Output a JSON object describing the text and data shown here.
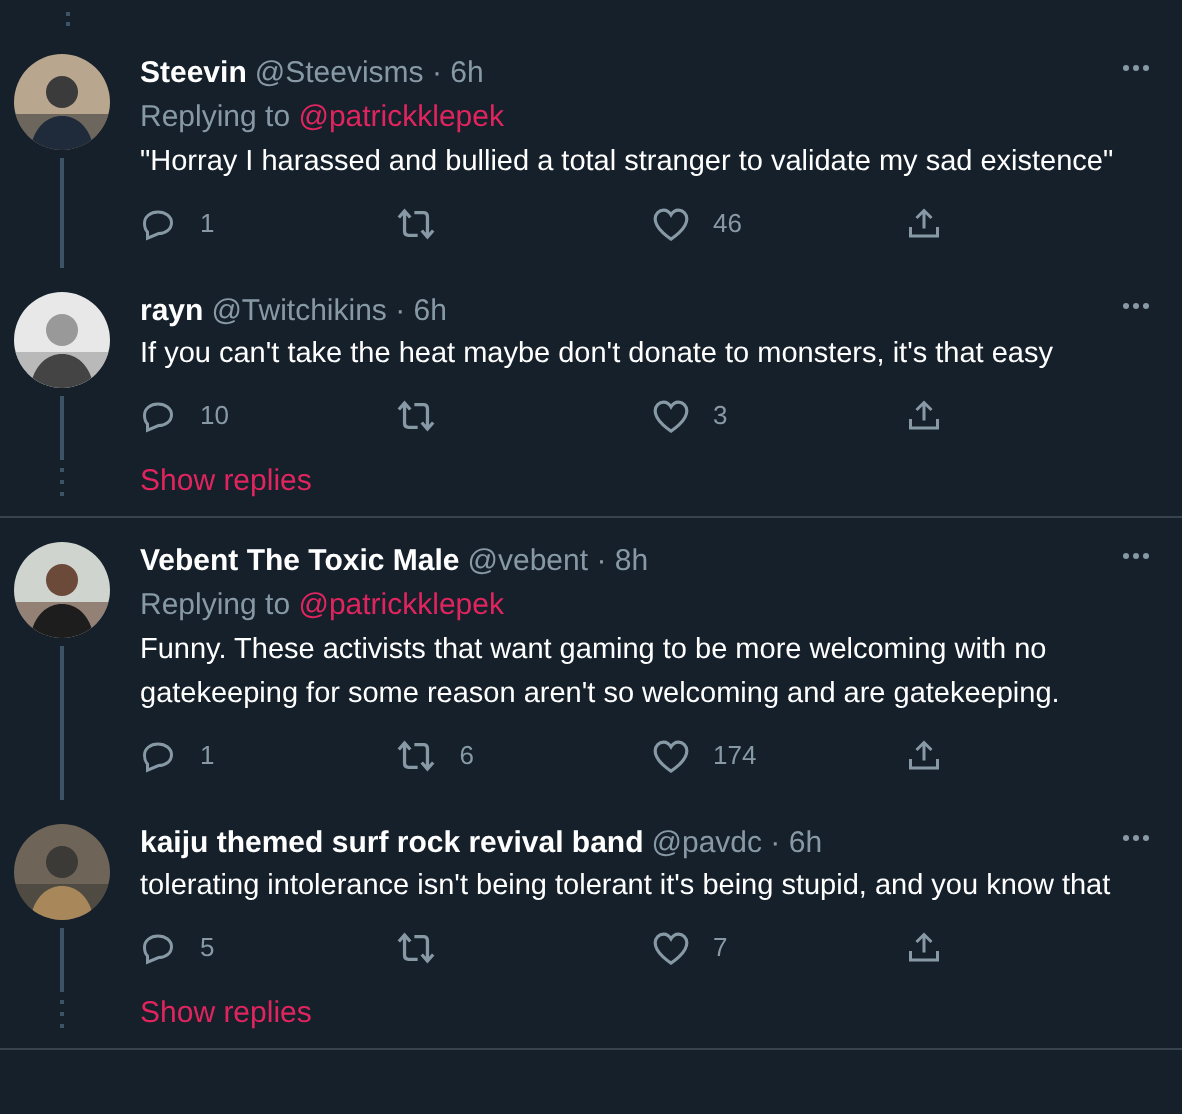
{
  "threads": [
    {
      "tweets": [
        {
          "name": "Steevin",
          "meta": "@Steevisms · 6h",
          "replying_label": "Replying to",
          "replying_user": "@patrickklepek",
          "text": "\"Horray I harassed and bullied a total stranger to validate my sad existence\"",
          "replies": "1",
          "likes": "46"
        },
        {
          "name": "rayn",
          "meta": "@Twitchikins · 6h",
          "text": "If you can't take the heat maybe don't donate to monsters, it's that easy",
          "replies": "10",
          "likes": "3"
        }
      ],
      "show_replies": "Show replies"
    },
    {
      "tweets": [
        {
          "name": "Vebent The Toxic Male",
          "meta": "@vebent · 8h",
          "replying_label": "Replying to",
          "replying_user": "@patrickklepek",
          "text": "Funny. These activists that want gaming to be more welcoming with no gatekeeping for some reason aren't so welcoming and are gatekeeping.",
          "replies": "1",
          "retweets": "6",
          "likes": "174"
        },
        {
          "name": "kaiju themed surf rock revival band",
          "meta": "@pavdc · 6h",
          "text": "tolerating intolerance isn't being tolerant it's being stupid, and you know that",
          "replies": "5",
          "likes": "7"
        }
      ],
      "show_replies": "Show replies"
    }
  ]
}
